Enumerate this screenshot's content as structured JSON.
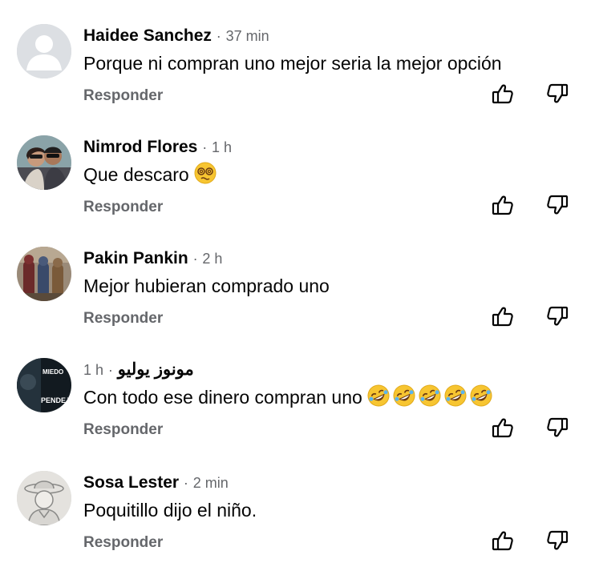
{
  "comments": [
    {
      "name": "Haidee Sanchez",
      "separator": "·",
      "time": "37 min",
      "text": "Porque ni compran uno mejor seria la mejor opción",
      "reply_label": "Responder",
      "avatar": "default-avatar"
    },
    {
      "name": "Nimrod Flores",
      "separator": "·",
      "time": "1 h",
      "text": "Que descaro",
      "emoji": "dizzy-face",
      "reply_label": "Responder",
      "avatar": "couple-photo"
    },
    {
      "name": "Pakin Pankin",
      "separator": "·",
      "time": "2 h",
      "text": "Mejor hubieran comprado uno",
      "reply_label": "Responder",
      "avatar": "superhero-figures-photo"
    },
    {
      "name": "مونوز يوليو",
      "separator": "·",
      "time": "1 h",
      "text": "Con todo ese dinero compran uno",
      "emoji": "rolling-on-floor-laughing x5",
      "reply_label": "Responder",
      "avatar": "poster-photo",
      "avatar_text": [
        "MIEDO",
        "PENDEJO."
      ]
    },
    {
      "name": "Sosa Lester",
      "separator": "·",
      "time": "2 min",
      "text": "Poquitillo dijo el niño.",
      "reply_label": "Responder",
      "avatar": "cowboy-sketch-photo"
    }
  ],
  "colors": {
    "text": "#050505",
    "secondary": "#65676b",
    "emoji_yellow": "#f7c531"
  }
}
